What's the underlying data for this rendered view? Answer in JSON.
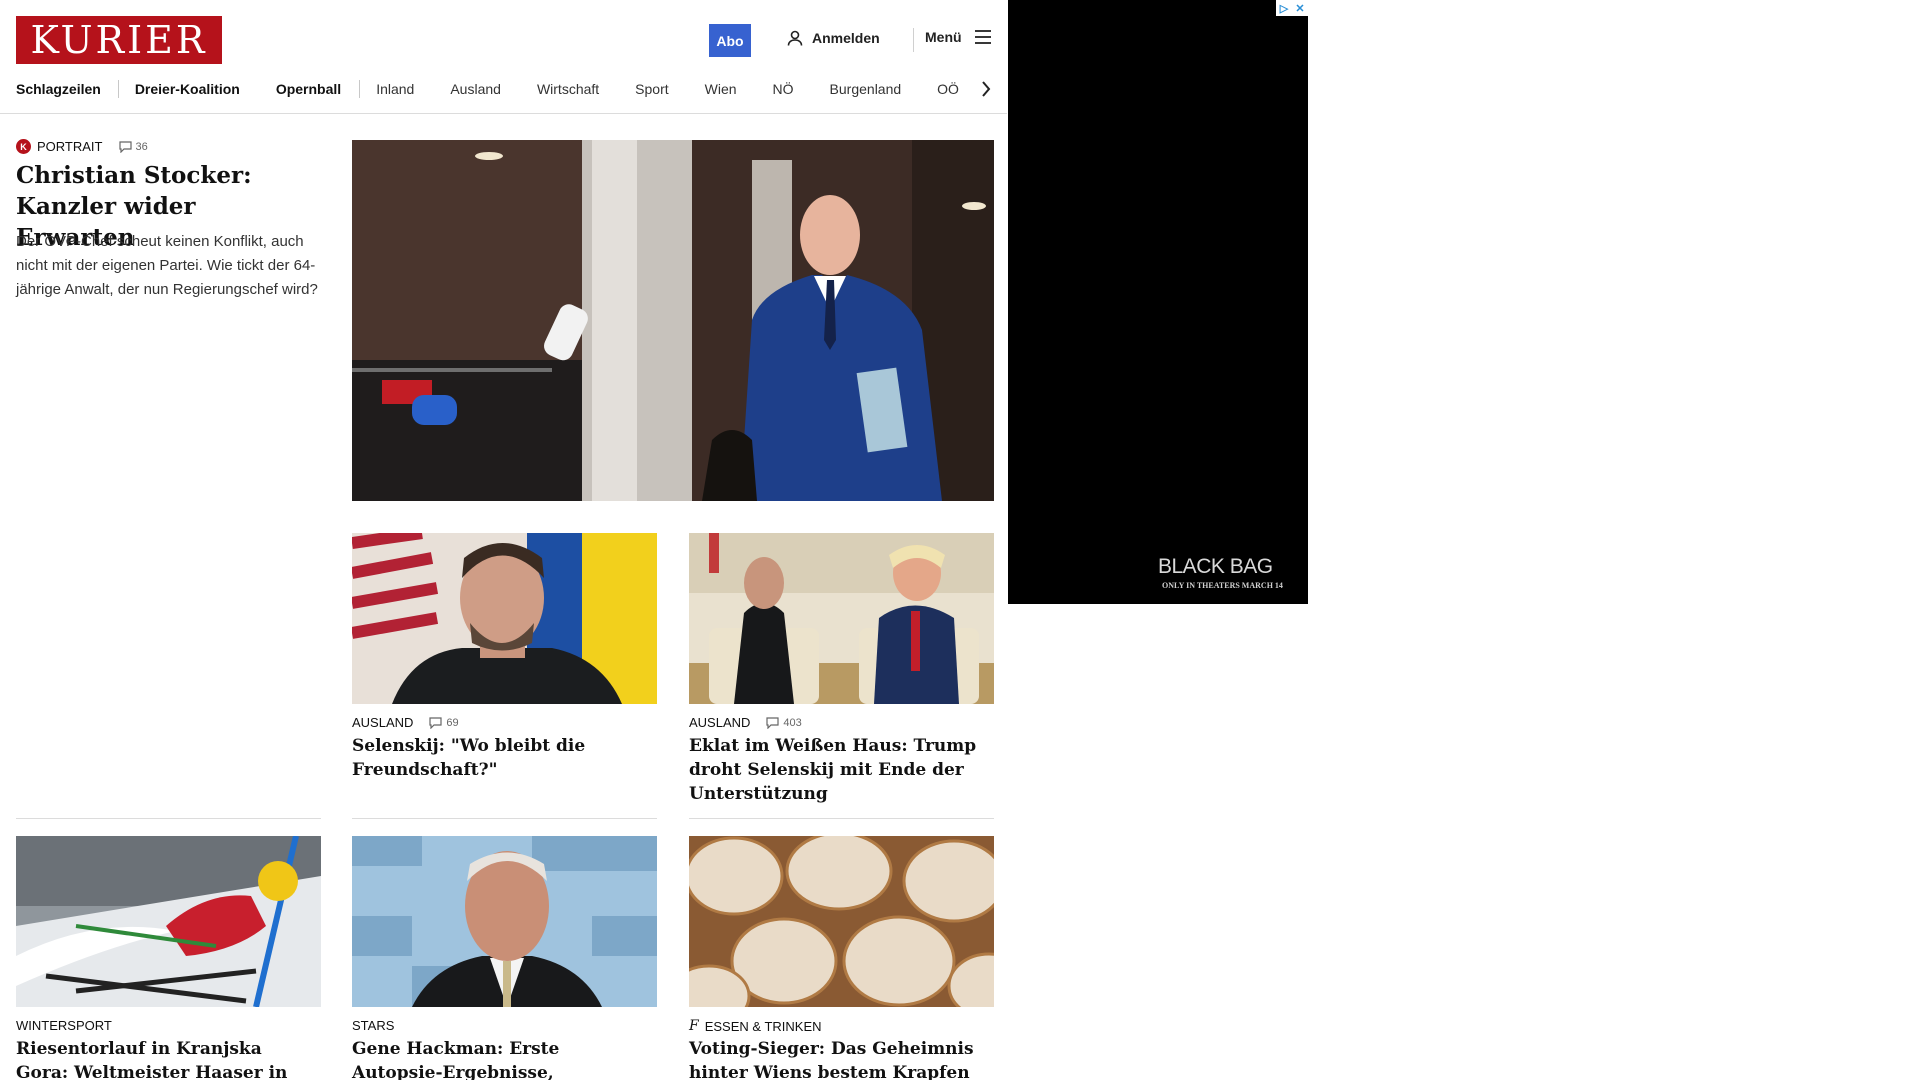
{
  "header": {
    "logo_text": "KURIER",
    "abo_label": "Abo",
    "login_label": "Anmelden",
    "menu_label": "Menü",
    "brand_color": "#b5121b",
    "abo_color": "#3762d0"
  },
  "nav": {
    "items": [
      {
        "label": "Schlagzeilen"
      },
      {
        "label": "Dreier-Koalition"
      },
      {
        "label": "Opernball"
      },
      {
        "label": "Inland"
      },
      {
        "label": "Ausland"
      },
      {
        "label": "Wirtschaft"
      },
      {
        "label": "Sport"
      },
      {
        "label": "Wien"
      },
      {
        "label": "NÖ"
      },
      {
        "label": "Burgenland"
      },
      {
        "label": "OÖ"
      }
    ]
  },
  "lead": {
    "badge": "K",
    "kicker": "PORTRAIT",
    "comments": "36",
    "title": "Christian Stocker: Kanzler wider Erwarten",
    "teaser": "Der ÖVP-Chef scheut keinen Konflikt, auch nicht mit der eigenen Partei. Wie tickt der 64-jährige Anwalt, der nun Regierungschef wird?"
  },
  "cards": [
    {
      "kicker": "AUSLAND",
      "comments": "69",
      "title": "Selenskij: \"Wo bleibt die Freundschaft?\""
    },
    {
      "kicker": "AUSLAND",
      "comments": "403",
      "title": "Eklat im Weißen Haus: Trump droht Selenskij mit Ende der Unterstützung"
    },
    {
      "kicker": "WINTERSPORT",
      "title": "Riesentorlauf in Kranjska Gora: Weltmeister Haaser in Lauerstellung"
    },
    {
      "kicker": "STARS",
      "title": "Gene Hackman: Erste Autopsie-Ergebnisse, Auswertung seines Herzschrittmachers sind da"
    },
    {
      "kicker": "ESSEN & TRINKEN",
      "kicker_icon": "f",
      "title": "Voting-Sieger: Das Geheimnis hinter Wiens bestem Krapfen"
    }
  ],
  "ad": {
    "title": "BLACK BAG",
    "subtitle": "ONLY IN THEATERS MARCH 14"
  }
}
